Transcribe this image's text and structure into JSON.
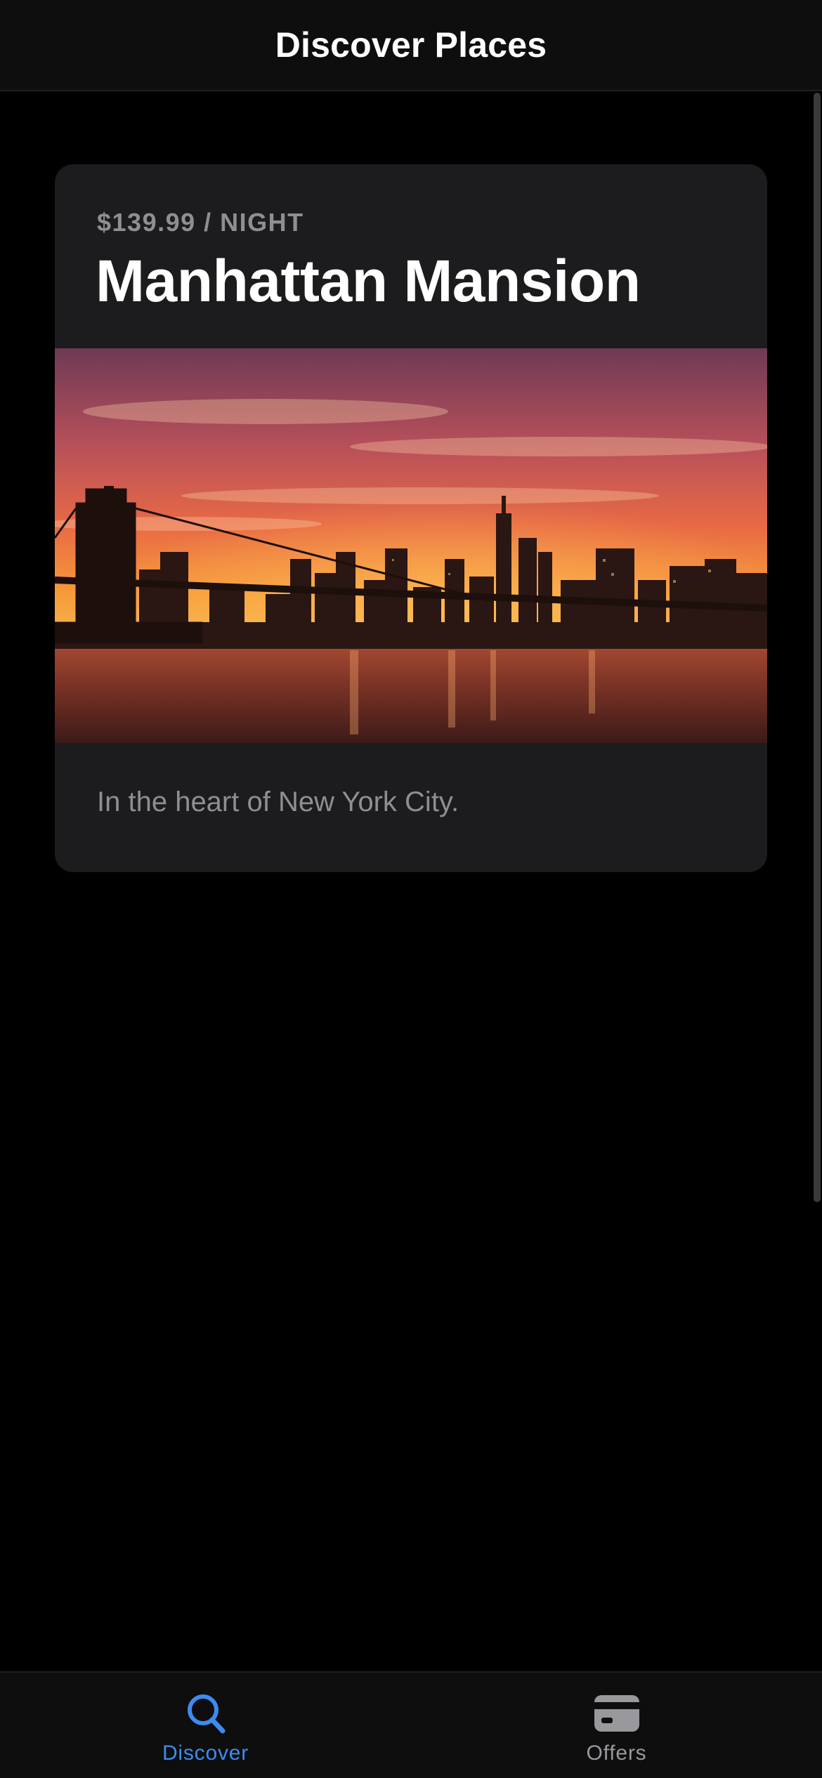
{
  "header": {
    "title": "Discover Places"
  },
  "place_card": {
    "price": "$139.99 / NIGHT",
    "title": "Manhattan Mansion",
    "image": "manhattan-skyline-sunset-photo",
    "description": "In the heart of New York City."
  },
  "tab_bar": {
    "tabs": [
      {
        "label": "Discover",
        "icon": "search-icon",
        "active": true
      },
      {
        "label": "Offers",
        "icon": "card-icon",
        "active": false
      }
    ]
  },
  "colors": {
    "background": "#000000",
    "bar_background": "#0e0e0e",
    "card_background": "#1c1c1e",
    "secondary_text": "#8e8e93",
    "accent": "#3d8bf0",
    "inactive_tab": "#98989d"
  }
}
